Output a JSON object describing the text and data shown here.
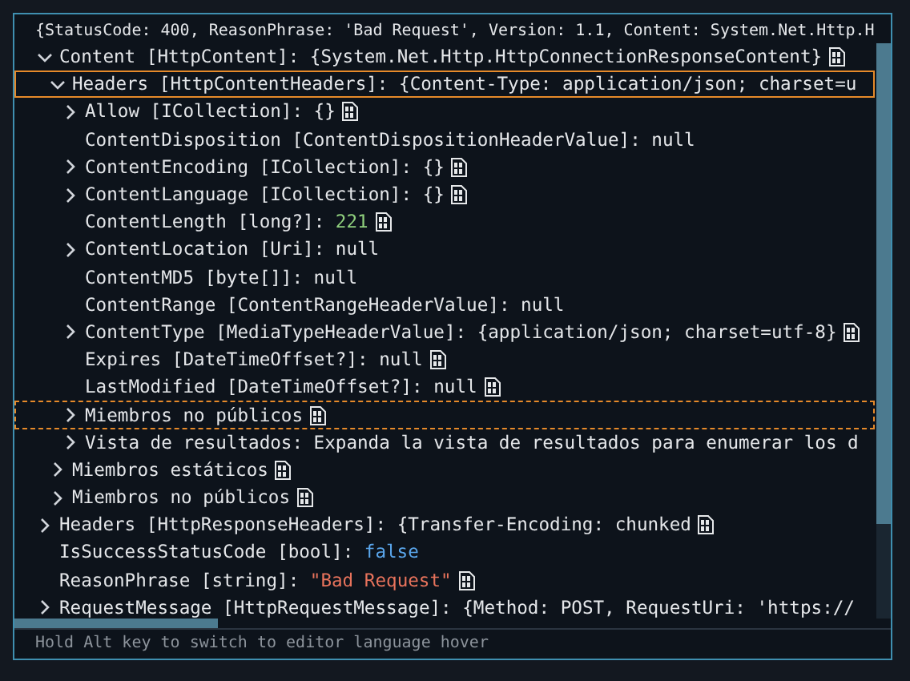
{
  "hover": {
    "summary": "{StatusCode: 400, ReasonPhrase: 'Bad Request', Version: 1.1, Content: System.Net.Http.H",
    "tree": [
      {
        "label": "Content [HttpContent]:",
        "value": "{System.Net.Http.HttpConnectionResponseContent}",
        "color": "#e4e6e9",
        "expandable": true,
        "expanded": true,
        "selected": false,
        "focused": false,
        "viz": true,
        "children": [
          {
            "label": "Headers [HttpContentHeaders]:",
            "value": "{Content-Type: application/json; charset=u",
            "color": "#e4e6e9",
            "expandable": true,
            "expanded": true,
            "selected": true,
            "focused": false,
            "children": [
              {
                "label": "Allow [ICollection]:",
                "value": "{}",
                "color": "#e4e6e9",
                "expandable": true,
                "expanded": false,
                "selected": false,
                "focused": false,
                "viz": true
              },
              {
                "label": "ContentDisposition [ContentDispositionHeaderValue]:",
                "value": "null",
                "color": "#e4e6e9",
                "expandable": false,
                "selected": false,
                "focused": false
              },
              {
                "label": "ContentEncoding [ICollection]:",
                "value": "{}",
                "color": "#e4e6e9",
                "expandable": true,
                "expanded": false,
                "selected": false,
                "focused": false,
                "viz": true
              },
              {
                "label": "ContentLanguage [ICollection]:",
                "value": "{}",
                "color": "#e4e6e9",
                "expandable": true,
                "expanded": false,
                "selected": false,
                "focused": false,
                "viz": true
              },
              {
                "label": "ContentLength [long?]:",
                "value": "221",
                "color": "#8fcf7d",
                "expandable": false,
                "selected": false,
                "focused": false,
                "viz": true
              },
              {
                "label": "ContentLocation [Uri]:",
                "value": "null",
                "color": "#e4e6e9",
                "expandable": true,
                "expanded": false,
                "selected": false,
                "focused": false
              },
              {
                "label": "ContentMD5 [byte[]]:",
                "value": "null",
                "color": "#e4e6e9",
                "expandable": false,
                "selected": false,
                "focused": false
              },
              {
                "label": "ContentRange [ContentRangeHeaderValue]:",
                "value": "null",
                "color": "#e4e6e9",
                "expandable": false,
                "selected": false,
                "focused": false
              },
              {
                "label": "ContentType [MediaTypeHeaderValue]:",
                "value": "{application/json; charset=utf-8}",
                "color": "#e4e6e9",
                "expandable": true,
                "expanded": false,
                "selected": false,
                "focused": false,
                "viz": true
              },
              {
                "label": "Expires [DateTimeOffset?]:",
                "value": "null",
                "color": "#e4e6e9",
                "expandable": false,
                "selected": false,
                "focused": false,
                "viz": true
              },
              {
                "label": "LastModified [DateTimeOffset?]:",
                "value": "null",
                "color": "#e4e6e9",
                "expandable": false,
                "selected": false,
                "focused": false,
                "viz": true
              },
              {
                "label": "Miembros no públicos",
                "expandable": true,
                "expanded": false,
                "selected": false,
                "focused": true,
                "viz": true
              },
              {
                "label": "Vista de resultados:",
                "value": "Expanda la vista de resultados para enumerar los d",
                "color": "#e4e6e9",
                "expandable": true,
                "expanded": false,
                "selected": false,
                "focused": false
              }
            ]
          },
          {
            "label": "Miembros estáticos",
            "expandable": true,
            "expanded": false,
            "selected": false,
            "focused": false,
            "viz": true
          },
          {
            "label": "Miembros no públicos",
            "expandable": true,
            "expanded": false,
            "selected": false,
            "focused": false,
            "viz": true
          }
        ]
      },
      {
        "label": "Headers [HttpResponseHeaders]:",
        "value": "{Transfer-Encoding: chunked",
        "color": "#e4e6e9",
        "expandable": true,
        "expanded": false,
        "selected": false,
        "focused": false,
        "viz": true
      },
      {
        "label": "IsSuccessStatusCode [bool]:",
        "value": "false",
        "color": "#5aa6ec",
        "expandable": false,
        "selected": false,
        "focused": false
      },
      {
        "label": "ReasonPhrase [string]:",
        "value": "\"Bad Request\"",
        "color": "#e8735c",
        "expandable": false,
        "selected": false,
        "focused": false,
        "viz": true
      },
      {
        "label": "RequestMessage [HttpRequestMessage]:",
        "value": "{Method: POST, RequestUri: 'https://",
        "color": "#e4e6e9",
        "expandable": true,
        "expanded": false,
        "selected": false,
        "focused": false
      }
    ],
    "footer": "Hold Alt key to switch to editor language hover"
  }
}
